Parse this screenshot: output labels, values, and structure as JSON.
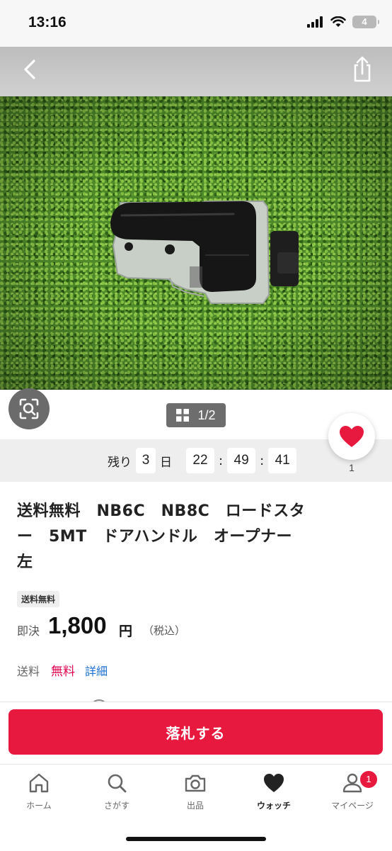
{
  "status_bar": {
    "time": "13:16",
    "battery": "4"
  },
  "header": {
    "back_icon": "chevron-left-icon",
    "share_icon": "share-icon"
  },
  "gallery": {
    "page_indicator": "1/2",
    "lens_icon": "image-search-icon"
  },
  "watch": {
    "count": "1",
    "icon": "heart-icon",
    "color": "#e8193f"
  },
  "countdown": {
    "remaining_label": "残り",
    "days": "3",
    "days_unit": "日",
    "hours": "22",
    "minutes": "49",
    "seconds": "41",
    "separator": ":"
  },
  "product": {
    "title_line1": "送料無料　NB6C　NB8C　ロードスタ",
    "title_line2": "ー　5MT　ドアハンドル　オープナー",
    "title_line3": "左",
    "badge": "送料無料",
    "buy_now_label": "即決",
    "price": "1,800",
    "currency": "円",
    "tax_note": "（税込）"
  },
  "shipping": {
    "label": "送料",
    "value": "無料",
    "details_link": "詳細",
    "value_color": "#e0004d",
    "link_color": "#1a6fd1"
  },
  "action": {
    "bid_button": "落札する",
    "color": "#e8193f"
  },
  "bottom_nav": {
    "items": [
      {
        "label": "ホーム",
        "icon": "home-icon"
      },
      {
        "label": "さがす",
        "icon": "search-icon"
      },
      {
        "label": "出品",
        "icon": "camera-icon"
      },
      {
        "label": "ウォッチ",
        "icon": "heart-icon"
      },
      {
        "label": "マイページ",
        "icon": "person-icon",
        "badge": "1"
      }
    ]
  }
}
